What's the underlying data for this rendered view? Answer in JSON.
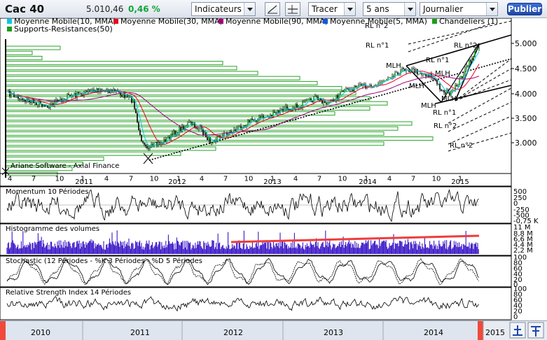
{
  "toolbar": {
    "title": "Cac 40",
    "price": "5.010,46",
    "change": "0,46 %",
    "indicators_label": "Indicateurs",
    "draw_label": "Tracer",
    "period_value": "5 ans",
    "interval_value": "Journalier",
    "publish_label": "Publier",
    "colors": {
      "change": "#13a43a",
      "publish": "#1e47a8"
    }
  },
  "legend": [
    {
      "label": "Moyenne Mobile(10, MMA)",
      "color": "#00c8e8"
    },
    {
      "label": "Moyenne Mobile(30, MMA)",
      "color": "#e8001c"
    },
    {
      "label": "Moyenne Mobile(90, MMA)",
      "color": "#a0007a"
    },
    {
      "label": "Moyenne Mobile(5, MMA)",
      "color": "#1058e0"
    },
    {
      "label": "Chandeliers (1)",
      "color": "#1a9e1a"
    },
    {
      "label": "Supports-Resistances(50)",
      "color": "#1a9e1a"
    }
  ],
  "price_axis": [
    "5.000",
    "4.500",
    "4.000",
    "3.500",
    "3.000"
  ],
  "annotations": {
    "rl1": "RL n°1",
    "rl2": "RL n°2",
    "mlh": "MLH",
    "rl1_lower": "RL n°1",
    "rl2_lower": "RL n°2",
    "rl2_bottom": "RL n°2"
  },
  "watermark": "Ariane Software - Axial Finance",
  "month_ticks": [
    "4",
    "7",
    "10",
    "1",
    "4",
    "7",
    "10",
    "1",
    "4",
    "7",
    "10",
    "1",
    "4",
    "7",
    "10",
    "1",
    "4",
    "7",
    "10",
    "1"
  ],
  "year_ticks": [
    "2011",
    "2012",
    "2013",
    "2014",
    "2015"
  ],
  "panels": {
    "momentum": {
      "title": "Momentum 10 Périodes",
      "axis": [
        "500",
        "250",
        "0",
        "-250",
        "-500",
        "-0,75 K"
      ]
    },
    "volume": {
      "title": "Histogramme des volumes",
      "axis": [
        "11 M",
        "8,8 M",
        "6,6 M",
        "4,4 M",
        "2,2 M"
      ]
    },
    "stochastic": {
      "title": "Stochastic (12 Périodes - %K 3 Périodes - %D 5 Périodes",
      "axis": [
        "100",
        "80",
        "60",
        "40",
        "20",
        "0"
      ]
    },
    "rsi": {
      "title": "Relative Strength Index 14 Périodes",
      "axis": [
        "100",
        "80",
        "60",
        "40",
        "20",
        "0"
      ]
    }
  },
  "navigator": {
    "years": [
      "2010",
      "2011",
      "2012",
      "2013",
      "2014",
      "2015"
    ]
  }
}
